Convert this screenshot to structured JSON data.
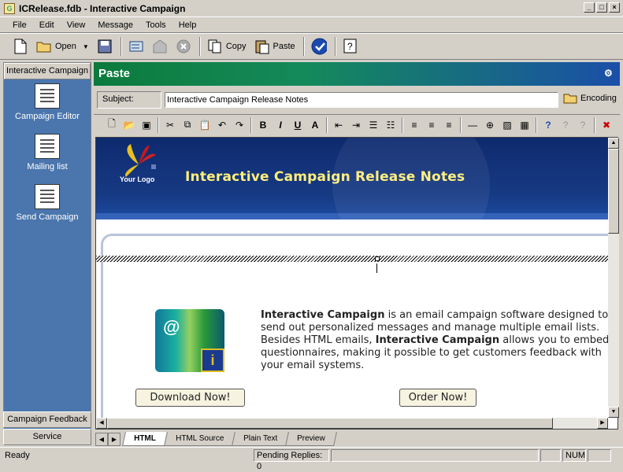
{
  "window": {
    "title": "ICRelease.fdb - Interactive Campaign",
    "app_icon": "G"
  },
  "menu": [
    "File",
    "Edit",
    "View",
    "Message",
    "Tools",
    "Help"
  ],
  "toolbar": {
    "open_label": "Open",
    "copy_label": "Copy",
    "paste_label": "Paste"
  },
  "sidebar": {
    "header": "Interactive Campaign",
    "items": [
      {
        "label": "Campaign Editor",
        "icon": "document-pencil-icon"
      },
      {
        "label": "Mailing list",
        "icon": "document-pencil-icon"
      },
      {
        "label": "Send Campaign",
        "icon": "document-pencil-icon"
      }
    ],
    "bottom": [
      "Campaign Feedback",
      "Service"
    ]
  },
  "panel": {
    "title": "Paste"
  },
  "subject": {
    "label": "Subject:",
    "value": "Interactive Campaign Release Notes",
    "encoding_label": "Encoding"
  },
  "email": {
    "logo_text": "Your Logo",
    "banner_title": "Interactive Campaign Release Notes",
    "desc_line1_bold": "Interactive Campaign",
    "desc_line1_rest": " is an email campaign software designed to",
    "desc_line2": "send out personalized messages and manage multiple email lists.",
    "desc_line3_pre": "Besides HTML emails, ",
    "desc_line3_bold": "Interactive Campaign",
    "desc_line3_rest": " allows you to embed",
    "desc_line4": "questionnaires, making it possible to get customers feedback with",
    "desc_line5": "your email systems.",
    "download_label": "Download Now!",
    "order_label": "Order Now!"
  },
  "tabs": [
    "HTML",
    "HTML Source",
    "Plain Text",
    "Preview"
  ],
  "status": {
    "ready": "Ready",
    "pending": "Pending Replies: 0",
    "num": "NUM"
  }
}
